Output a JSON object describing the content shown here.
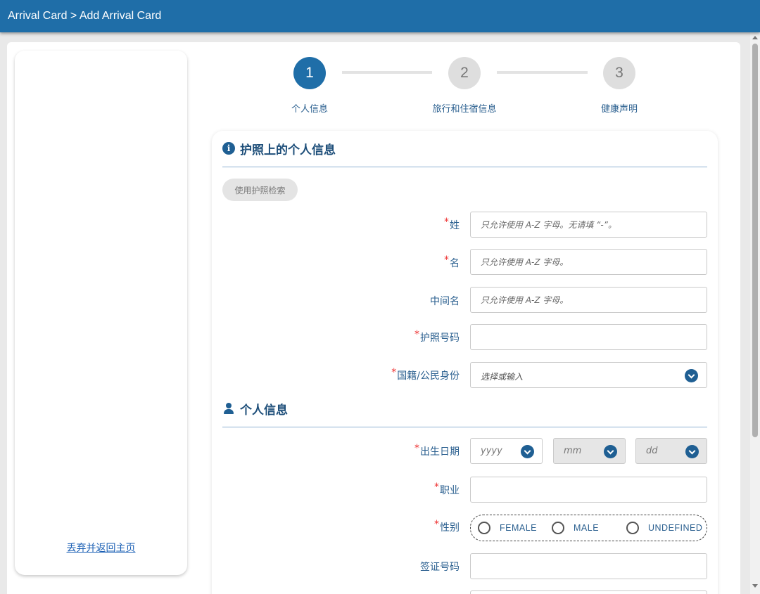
{
  "header": {
    "title": "Arrival Card > Add Arrival Card"
  },
  "sidebar": {
    "discard_link": "丢弃并返回主页"
  },
  "stepper": {
    "steps": [
      {
        "number": "1",
        "label": "个人信息",
        "active": true
      },
      {
        "number": "2",
        "label": "旅行和住宿信息",
        "active": false
      },
      {
        "number": "3",
        "label": "健康声明",
        "active": false
      }
    ]
  },
  "passport_section": {
    "title": "护照上的个人信息",
    "search_button": "使用护照检索",
    "required_mark": "*",
    "fields": {
      "surname": {
        "label": "姓",
        "placeholder": "只允许使用 A-Z 字母。无请填 “-”。"
      },
      "given_name": {
        "label": "名",
        "placeholder": "只允许使用 A-Z 字母。"
      },
      "middle_name": {
        "label": "中间名",
        "placeholder": "只允许使用 A-Z 字母。"
      },
      "passport_no": {
        "label": "护照号码",
        "placeholder": ""
      },
      "nationality": {
        "label": "国籍/公民身份",
        "placeholder": "选择或输入"
      }
    }
  },
  "personal_section": {
    "title": "个人信息",
    "fields": {
      "dob": {
        "label": "出生日期",
        "year": "yyyy",
        "month": "mm",
        "day": "dd"
      },
      "occupation": {
        "label": "职业"
      },
      "gender": {
        "label": "性别",
        "options": [
          "FEMALE",
          "MALE",
          "UNDEFINED"
        ]
      },
      "visa_no": {
        "label": "签证号码"
      }
    }
  },
  "colors": {
    "primary": "#1f6ea8",
    "required": "#e33333",
    "label": "#2a5f8f"
  }
}
